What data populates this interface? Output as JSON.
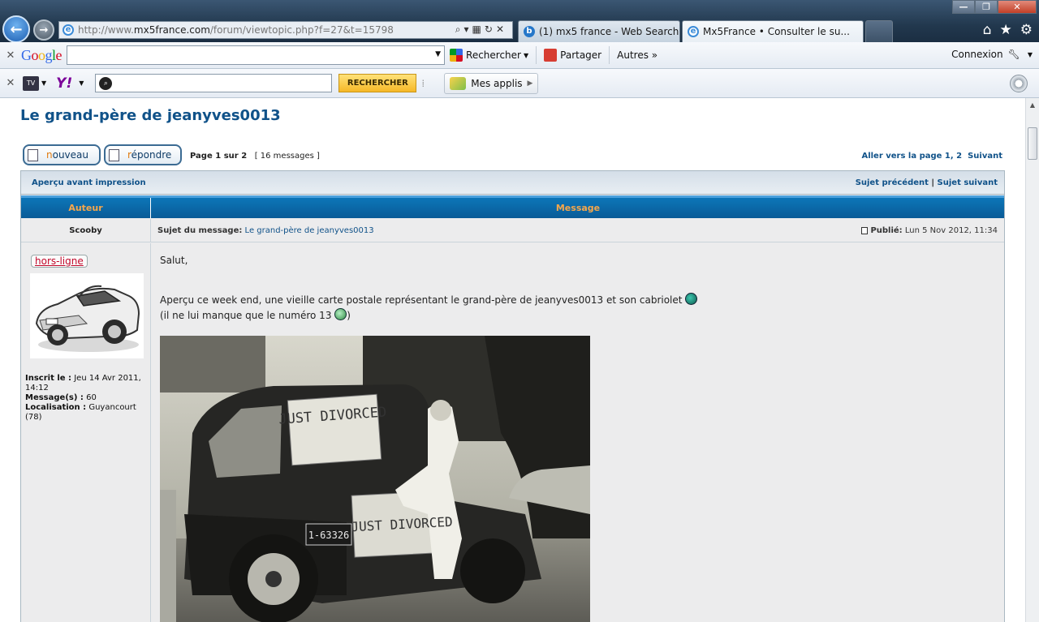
{
  "browser": {
    "address_url_prefix": "http://www.",
    "address_url_domain": "mx5france.com",
    "address_url_path": "/forum/viewtopic.php?f=27&t=15798",
    "tabs": [
      {
        "label": "(1) mx5 france - Web Search R..."
      },
      {
        "label": "Mx5France • Consulter le su..."
      }
    ]
  },
  "google_toolbar": {
    "search_label": "Rechercher",
    "share_label": "Partager",
    "more_label": "Autres »",
    "connect_label": "Connexion"
  },
  "yahoo_toolbar": {
    "search_button": "RECHERCHER",
    "apps_label": "Mes applis"
  },
  "topic": {
    "title": "Le grand-père de jeanyves0013",
    "new_button": "nouveau",
    "reply_button": "répondre",
    "page_prefix": "Page",
    "page_current": "1",
    "page_of": "sur",
    "page_total": "2",
    "messages_count": "[ 16 messages ]",
    "goto_label": "Aller vers la page",
    "goto_pages": "1, 2",
    "next_label": "Suivant",
    "print_preview": "Aperçu avant impression",
    "prev_subject": "Sujet précédent",
    "next_subject": "Sujet suivant"
  },
  "table": {
    "col_author": "Auteur",
    "col_message": "Message"
  },
  "post": {
    "author": "Scooby",
    "subject_label": "Sujet du message:",
    "subject": "Le grand-père de jeanyves0013",
    "published_label": "Publié:",
    "published_date": "Lun 5 Nov 2012, 11:34",
    "status": "hors-ligne",
    "joined_label": "Inscrit le :",
    "joined_date": "Jeu 14 Avr 2011, 14:12",
    "messages_label": "Message(s) :",
    "messages_value": "60",
    "location_label": "Localisation :",
    "location_value": "Guyancourt (78)",
    "line1": "Salut,",
    "line2": "Aperçu ce week end, une vieille carte postale représentant le grand-père de jeanyves0013 et son cabriolet",
    "line3_a": "(il ne lui manque que le numéro 13",
    "line3_b": ")",
    "photo_sign_top": "JUST DIVORCED",
    "photo_sign_bottom": "JUST DIVORCED",
    "photo_plate": "1-63326"
  },
  "colors": {
    "link": "#105289",
    "header_bg": "#0c76b8",
    "header_text": "#f6a74b"
  }
}
